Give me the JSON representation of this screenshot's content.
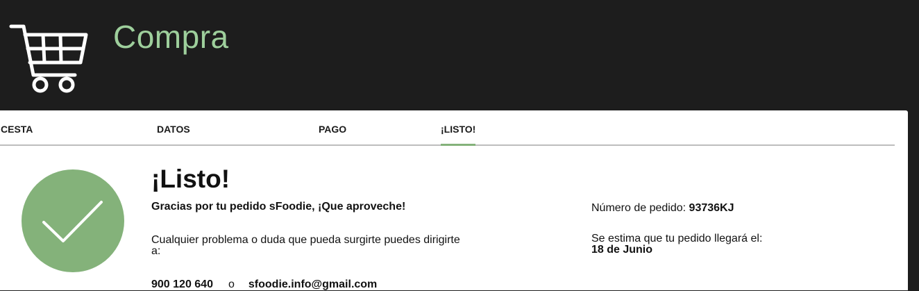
{
  "header": {
    "title": "Compra",
    "title_color": "#9ecf9c",
    "icon": "shopping-cart-icon"
  },
  "steps": [
    {
      "label": "CESTA",
      "active": false
    },
    {
      "label": "DATOS",
      "active": false
    },
    {
      "label": "PAGO",
      "active": false
    },
    {
      "label": "¡LISTO!",
      "active": true
    }
  ],
  "accent_color": "#84b27a",
  "confirmation": {
    "icon": "checkmark-icon",
    "title": "¡Listo!",
    "thanks": "Gracias por tu pedido sFoodie, ¡Que aproveche!",
    "help_text": "Cualquier problema o duda que pueda surgirte puedes dirigirte a:",
    "phone": "900 120 640",
    "or": "o",
    "email": "sfoodie.info@gmail.com"
  },
  "order": {
    "number_label": "Número de pedido:",
    "number": "93736KJ",
    "eta_label": "Se estima que tu pedido llegará el:",
    "eta_date": "18 de Junio"
  }
}
